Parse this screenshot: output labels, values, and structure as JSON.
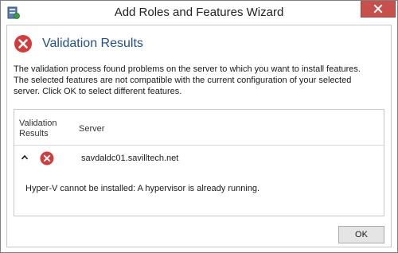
{
  "window": {
    "title": "Add Roles and Features Wizard"
  },
  "dialog": {
    "heading": "Validation Results",
    "description_lines": [
      "The validation process found problems on the server to which you want to install features.",
      "The selected features are not compatible with the current configuration of your selected",
      "server.  Click OK to select different features."
    ]
  },
  "results": {
    "column_headers": {
      "results_line1": "Validation",
      "results_line2": "Results",
      "server": "Server"
    },
    "rows": [
      {
        "server": "savdaldc01.savilltech.net",
        "status_icon": "error-icon",
        "expanded": true,
        "message": "Hyper-V cannot be installed: A hypervisor is already running."
      }
    ]
  },
  "buttons": {
    "ok_label": "OK"
  },
  "icons": {
    "app": "server-manager-icon",
    "close": "close-icon",
    "error": "error-icon",
    "collapse": "caret-up-icon"
  },
  "colors": {
    "heading": "#1f4f8f",
    "error_red": "#d43b3b",
    "close_button": "#c7504d",
    "button_face": "#e5e5e5"
  }
}
